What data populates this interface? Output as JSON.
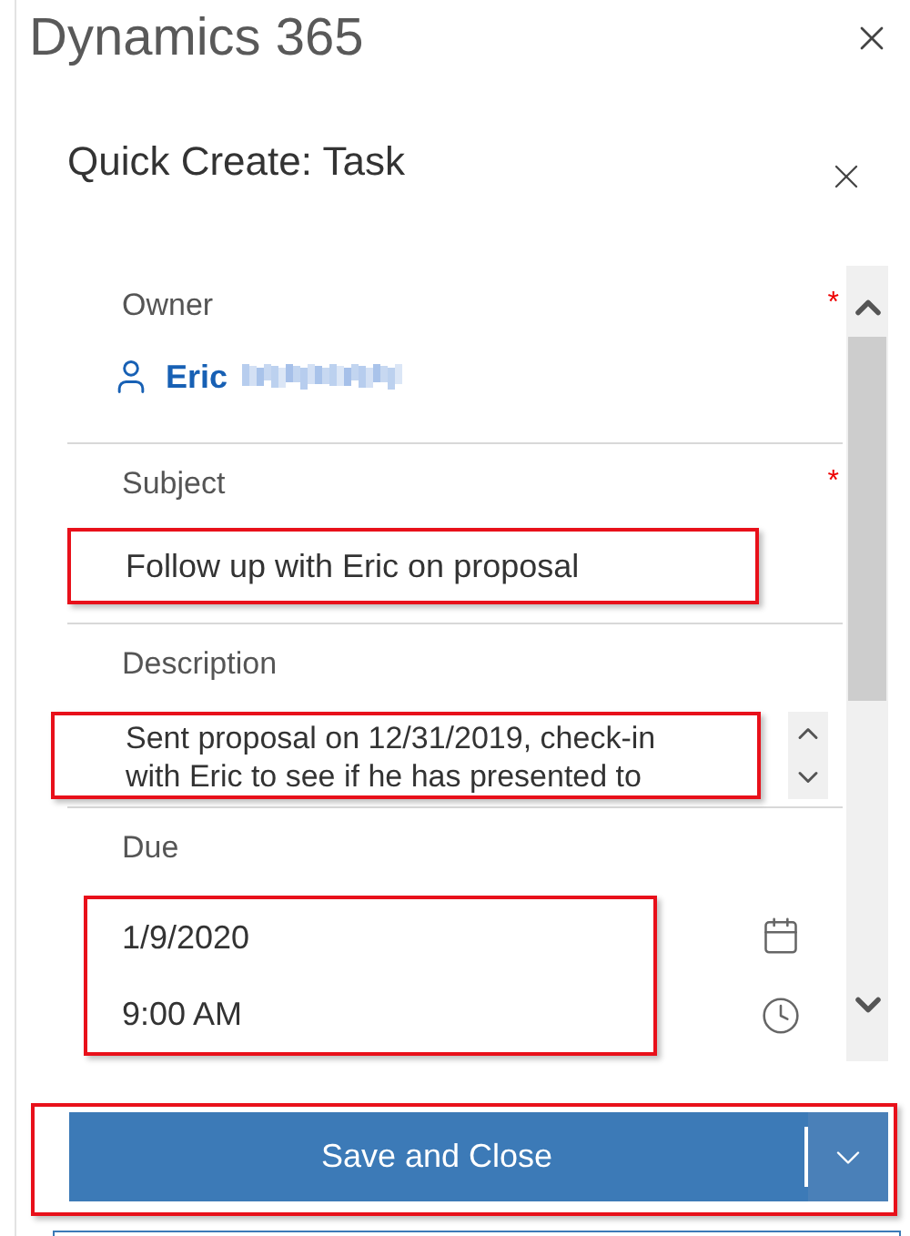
{
  "app_title": "Dynamics 365",
  "dialog": {
    "title": "Quick Create: Task"
  },
  "fields": [
    {
      "kind": "lookup",
      "label": "Owner",
      "required_mark": "*",
      "highlighted": false,
      "value": "Eric"
    },
    {
      "kind": "text",
      "label": "Subject",
      "required_mark": "*",
      "highlighted": true,
      "value": "Follow up with Eric on proposal"
    },
    {
      "kind": "multiline",
      "label": "Description",
      "highlighted": true,
      "value": "Sent proposal on 12/31/2019, check-in with Eric to see if he has presented to"
    },
    {
      "kind": "datetime",
      "label": "Due",
      "highlighted": true,
      "date": "1/9/2020",
      "time": "9:00 AM"
    }
  ],
  "save_button": {
    "label": "Save and Close",
    "highlighted": true
  }
}
